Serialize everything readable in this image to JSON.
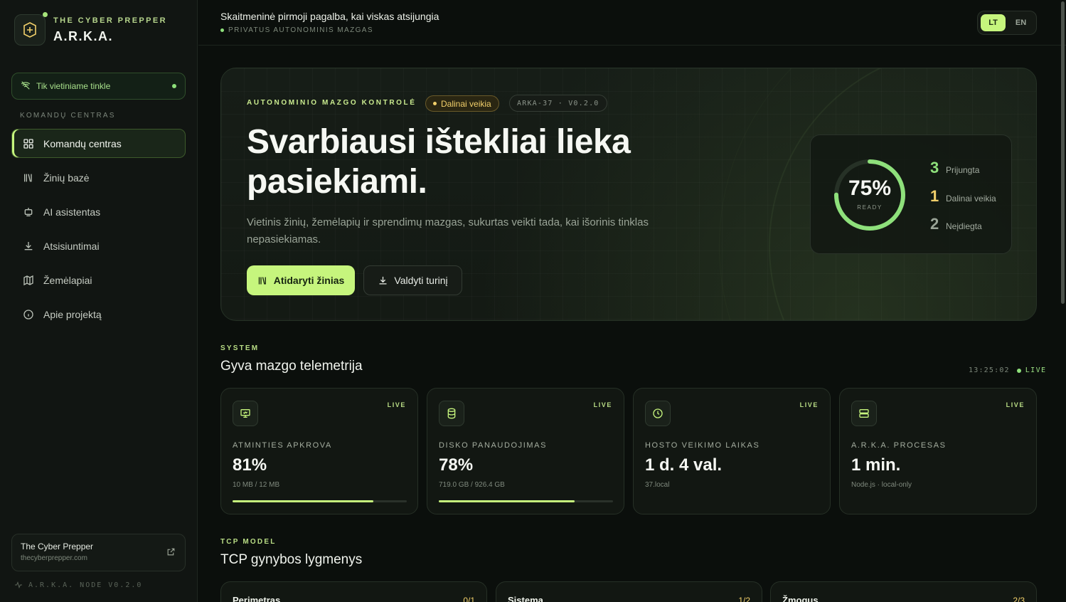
{
  "sidebar": {
    "brand_kicker": "THE CYBER PREPPER",
    "brand_name": "A.R.K.A.",
    "network_pill": "Tik vietiniame tinkle",
    "section_label": "KOMANDŲ CENTRAS",
    "items": [
      {
        "label": "Komandų centras",
        "icon": "grid-icon",
        "active": true
      },
      {
        "label": "Žinių bazė",
        "icon": "library-icon",
        "active": false
      },
      {
        "label": "AI asistentas",
        "icon": "robot-icon",
        "active": false
      },
      {
        "label": "Atsisiuntimai",
        "icon": "download-icon",
        "active": false
      },
      {
        "label": "Žemėlapiai",
        "icon": "map-icon",
        "active": false
      },
      {
        "label": "Apie projektą",
        "icon": "info-icon",
        "active": false
      }
    ],
    "footer_title": "The Cyber Prepper",
    "footer_url": "thecyberprepper.com",
    "version": "A.R.K.A. NODE V0.2.0"
  },
  "topbar": {
    "title": "Skaitmeninė pirmoji pagalba, kai viskas atsijungia",
    "subtitle": "PRIVATUS AUTONOMINIS MAZGAS",
    "lang_lt": "LT",
    "lang_en": "EN",
    "active_lang": "LT"
  },
  "hero": {
    "kicker": "AUTONOMINIO MAZGO KONTROLĖ",
    "badge_status": "Dalinai veikia",
    "badge_version": "ARKA-37 · V0.2.0",
    "title": "Svarbiausi ištekliai lieka pasiekiami.",
    "description": "Vietinis žinių, žemėlapių ir sprendimų mazgas, sukurtas veikti tada, kai išorinis tinklas nepasiekiamas.",
    "primary_button": "Atidaryti žinias",
    "secondary_button": "Valdyti turinį",
    "gauge_percent": "75%",
    "gauge_value": 0.75,
    "gauge_label": "READY",
    "stats": [
      {
        "count": "3",
        "label": "Prijungta",
        "color": "#8ee07b"
      },
      {
        "count": "1",
        "label": "Dalinai veikia",
        "color": "#f1cf6a"
      },
      {
        "count": "2",
        "label": "Neįdiegta",
        "color": "#9aa497"
      }
    ]
  },
  "telemetry": {
    "kicker": "SYSTEM",
    "title": "Gyva mazgo telemetrija",
    "time": "13:25:02",
    "live_label": "LIVE",
    "cards": [
      {
        "label": "ATMINTIES APKROVA",
        "value": "81%",
        "sub": "10 MB / 12 MB",
        "live": "LIVE",
        "icon": "monitor-icon",
        "progress": 0.81
      },
      {
        "label": "DISKO PANAUDOJIMAS",
        "value": "78%",
        "sub": "719.0 GB / 926.4 GB",
        "live": "LIVE",
        "icon": "database-icon",
        "progress": 0.78
      },
      {
        "label": "HOSTO VEIKIMO LAIKAS",
        "value": "1 d. 4 val.",
        "sub": "37.local",
        "live": "LIVE",
        "icon": "clock-icon",
        "progress": null
      },
      {
        "label": "A.R.K.A. PROCESAS",
        "value": "1 min.",
        "sub": "Node.js · local-only",
        "live": "LIVE",
        "icon": "server-icon",
        "progress": null
      }
    ]
  },
  "tcp": {
    "kicker": "TCP MODEL",
    "title": "TCP gynybos lygmenys",
    "layers": [
      {
        "name": "Perimetras",
        "fraction": "0/1"
      },
      {
        "name": "Sistema",
        "fraction": "1/2"
      },
      {
        "name": "Žmogus",
        "fraction": "2/3"
      }
    ]
  },
  "colors": {
    "accent": "#c6f57d",
    "live_green": "#8ee07b",
    "warning": "#f1cf6a",
    "background": "#0b0f0c"
  }
}
